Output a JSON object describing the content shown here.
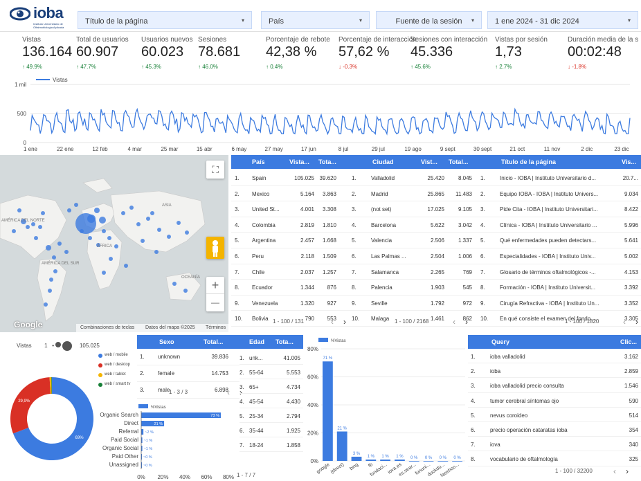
{
  "header": {
    "logo_text": "ioba",
    "logo_sub": "Instituto Universitario de Oftalmobiología Aplicada",
    "filters": [
      {
        "label": "Título de la página"
      },
      {
        "label": "País"
      },
      {
        "label": "Fuente de la sesión"
      },
      {
        "label": "1 ene 2024 - 31 dic 2024"
      }
    ]
  },
  "kpis": [
    {
      "label": "Vistas",
      "value": "136.164",
      "delta": "↑ 49.9%",
      "dir": "up"
    },
    {
      "label": "Total de usuarios",
      "value": "60.907",
      "delta": "↑ 47.7%",
      "dir": "up"
    },
    {
      "label": "Usuarios nuevos",
      "value": "60.023",
      "delta": "↑ 45.3%",
      "dir": "up"
    },
    {
      "label": "Sesiones",
      "value": "78.681",
      "delta": "↑ 46.0%",
      "dir": "up"
    },
    {
      "label": "Porcentaje de rebote",
      "value": "42,38 %",
      "delta": "↑ 0.4%",
      "dir": "up"
    },
    {
      "label": "Porcentaje de interacción",
      "value": "57,62 %",
      "delta": "↓ -0.3%",
      "dir": "down"
    },
    {
      "label": "Sesiones con interacción",
      "value": "45.336",
      "delta": "↑ 45.6%",
      "dir": "up"
    },
    {
      "label": "Vistas por sesión",
      "value": "1,73",
      "delta": "↑ 2.7%",
      "dir": "up"
    },
    {
      "label": "Duración media de la s",
      "value": "00:02:48",
      "delta": "↓ -1.8%",
      "dir": "down"
    }
  ],
  "linechart": {
    "legend": "Vistas",
    "y_ticks": [
      "1 mil",
      "500",
      "0"
    ],
    "x_ticks": [
      "1 ene",
      "22 ene",
      "12 feb",
      "4 mar",
      "25 mar",
      "15 abr",
      "6 may",
      "27 may",
      "17 jun",
      "8 jul",
      "29 jul",
      "19 ago",
      "9 sept",
      "30 sept",
      "21 oct",
      "11 nov",
      "2 dic",
      "23 dic"
    ],
    "color": "#3c7be0"
  },
  "map": {
    "labels": {
      "asia": "ASIA",
      "africa": "ÁFRICA",
      "america_n": "AMÉRICA DEL NORTE",
      "america_s": "AMÉRICA DEL SUR",
      "oceania": "OCEANÍA"
    },
    "google": "Google",
    "footer": [
      "Combinaciones de teclas",
      "Datos del mapa ©2025",
      "Términos"
    ],
    "zoom_in": "+",
    "zoom_out": "—"
  },
  "country_table": {
    "headers": [
      "País",
      "Vista...",
      "Tota..."
    ],
    "rows": [
      [
        "1.",
        "Spain",
        "105.025",
        "39.620"
      ],
      [
        "2.",
        "Mexico",
        "5.164",
        "3.863"
      ],
      [
        "3.",
        "United St...",
        "4.001",
        "3.308"
      ],
      [
        "4.",
        "Colombia",
        "2.819",
        "1.810"
      ],
      [
        "5.",
        "Argentina",
        "2.457",
        "1.668"
      ],
      [
        "6.",
        "Peru",
        "2.118",
        "1.509"
      ],
      [
        "7.",
        "Chile",
        "2.037",
        "1.257"
      ],
      [
        "8.",
        "Ecuador",
        "1.344",
        "876"
      ],
      [
        "9.",
        "Venezuela",
        "1.320",
        "927"
      ],
      [
        "10.",
        "Bolivia",
        "790",
        "553"
      ]
    ],
    "pager": "1 - 100 / 131"
  },
  "city_table": {
    "headers": [
      "Ciudad",
      "Vist...",
      "Total..."
    ],
    "rows": [
      [
        "1.",
        "Valladolid",
        "25.420",
        "8.045"
      ],
      [
        "2.",
        "Madrid",
        "25.865",
        "11.483"
      ],
      [
        "3.",
        "(not set)",
        "17.025",
        "9.105"
      ],
      [
        "4.",
        "Barcelona",
        "5.622",
        "3.042"
      ],
      [
        "5.",
        "Valencia",
        "2.506",
        "1.337"
      ],
      [
        "6.",
        "Las Palmas ...",
        "2.504",
        "1.006"
      ],
      [
        "7.",
        "Salamanca",
        "2.265",
        "769"
      ],
      [
        "8.",
        "Palencia",
        "1.903",
        "545"
      ],
      [
        "9.",
        "Seville",
        "1.792",
        "972"
      ],
      [
        "10.",
        "Malaga",
        "1.461",
        "862"
      ]
    ],
    "pager": "1 - 100 / 2168"
  },
  "page_table": {
    "headers": [
      "Título de la página",
      "Vis..."
    ],
    "rows": [
      [
        "1.",
        "Inicio - IOBA | Instituto Universitario d...",
        "20.7..."
      ],
      [
        "2.",
        "Equipo IOBA - IOBA | Instituto Univers...",
        "9.034"
      ],
      [
        "3.",
        "Pide Cita - IOBA | Instituto Universitari...",
        "8.422"
      ],
      [
        "4.",
        "Clínica - IOBA | Instituto Universitario ...",
        "5.996"
      ],
      [
        "5.",
        "Qué enfermedades pueden detectars...",
        "5.641"
      ],
      [
        "6.",
        "Especialidades - IOBA | Instituto Univ...",
        "5.002"
      ],
      [
        "7.",
        "Glosario de términos oftalmológicos -...",
        "4.153"
      ],
      [
        "8.",
        "Formación - IOBA | Instituto Universit...",
        "3.392"
      ],
      [
        "9.",
        "Cirugía Refractiva - IOBA | Instituto Un...",
        "3.352"
      ],
      [
        "10.",
        "En qué consiste el examen del fondo ...",
        "3.305"
      ]
    ],
    "pager": "1 - 100 / 1820"
  },
  "donut": {
    "metric_label": "Vistas",
    "range": "1",
    "total": "105.025",
    "slices": [
      {
        "name": "web / mobile",
        "value": 69.2,
        "color": "#3c7be0",
        "label": "69%"
      },
      {
        "name": "web / desktop",
        "value": 29.9,
        "color": "#d93025",
        "label": "29,9%"
      },
      {
        "name": "web / tablet",
        "value": 0.7,
        "color": "#f4b400",
        "label": ""
      },
      {
        "name": "web / smart tv",
        "value": 0.2,
        "color": "#188038",
        "label": ""
      }
    ],
    "pager": "1 - 3 / 3"
  },
  "sex_table": {
    "headers": [
      "Sexo",
      "Total..."
    ],
    "rows": [
      [
        "1.",
        "unknown",
        "39.836"
      ],
      [
        "2.",
        "female",
        "14.753"
      ],
      [
        "3.",
        "male",
        "6.898"
      ]
    ],
    "pager": "1 - 3 / 3"
  },
  "age_table": {
    "headers": [
      "Edad",
      "Tota..."
    ],
    "rows": [
      [
        "1.",
        "unk...",
        "41.005"
      ],
      [
        "2.",
        "55-64",
        "5.553"
      ],
      [
        "3.",
        "65+",
        "4.734"
      ],
      [
        "4.",
        "45-54",
        "4.430"
      ],
      [
        "5.",
        "25-34",
        "2.794"
      ],
      [
        "6.",
        "35-44",
        "1.925"
      ],
      [
        "7.",
        "18-24",
        "1.858"
      ]
    ],
    "pager": "1 - 7 / 7"
  },
  "channel_chart": {
    "legend": "%Vistas",
    "x_ticks": [
      "0%",
      "20%",
      "40%",
      "60%",
      "80%"
    ]
  },
  "source_chart": {
    "legend": "%Vistas",
    "y_ticks": [
      "80%",
      "60%",
      "40%",
      "20%",
      "0%"
    ]
  },
  "query_table": {
    "headers": [
      "Query",
      "Clic..."
    ],
    "rows": [
      [
        "1.",
        "ioba valladolid",
        "3.162"
      ],
      [
        "2.",
        "ioba",
        "2.859"
      ],
      [
        "3.",
        "ioba valladolid precio consulta",
        "1.546"
      ],
      [
        "4.",
        "tumor cerebral síntomas ojo",
        "590"
      ],
      [
        "5.",
        "nevus coroideo",
        "514"
      ],
      [
        "6.",
        "precio operación cataratas ioba",
        "354"
      ],
      [
        "7.",
        "iova",
        "340"
      ],
      [
        "8.",
        "vocabulario de oftalmología",
        "325"
      ]
    ],
    "pager": "1 - 100 / 32200"
  },
  "chart_data": [
    {
      "type": "line",
      "series": [
        {
          "name": "Vistas"
        }
      ],
      "ylim": [
        0,
        1000
      ],
      "y_ticks": [
        "0",
        "500",
        "1 mil"
      ],
      "x_ticks": [
        "1 ene",
        "22 ene",
        "12 feb",
        "4 mar",
        "25 mar",
        "15 abr",
        "6 may",
        "27 may",
        "17 jun",
        "8 jul",
        "29 jul",
        "19 ago",
        "9 sept",
        "30 sept",
        "21 oct",
        "11 nov",
        "2 dic",
        "23 dic"
      ]
    },
    {
      "type": "bar",
      "orientation": "horizontal",
      "series": [
        {
          "name": "%Vistas"
        }
      ],
      "categories": [
        "Organic Search",
        "Direct",
        "Referral",
        "Paid Social",
        "Organic Social",
        "Paid Other",
        "Unassigned"
      ],
      "values": [
        73,
        21,
        2,
        1,
        1,
        0,
        0
      ],
      "labels": [
        "73 %",
        "21 %",
        "~2 %",
        "~1 %",
        "~1 %",
        "~0 %",
        "~0 %"
      ],
      "xlim": [
        0,
        80
      ]
    },
    {
      "type": "bar",
      "series": [
        {
          "name": "%Vistas"
        }
      ],
      "categories": [
        "google",
        "(direct)",
        "bing",
        "fb",
        "fondaci...",
        "iova.es",
        "es.sear...",
        "fununi...",
        "duckdu...",
        "faceboo..."
      ],
      "values": [
        71,
        21,
        3,
        1,
        1,
        1,
        0,
        0,
        0,
        0
      ],
      "labels": [
        "71 %",
        "21 %",
        "3 %",
        "1 %",
        "1 %",
        "1 %",
        "0 %",
        "0 %",
        "0 %",
        "0 %"
      ],
      "ylim": [
        0,
        80
      ]
    }
  ]
}
